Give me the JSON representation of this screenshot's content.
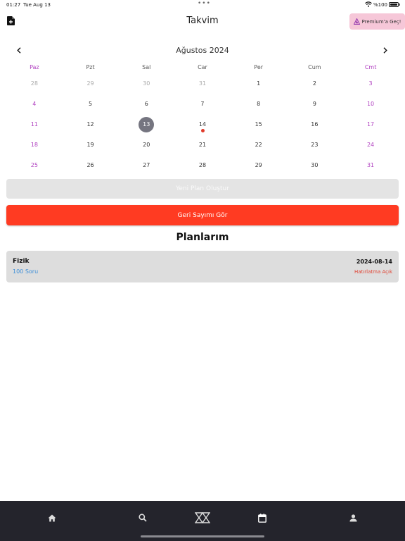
{
  "status_bar": {
    "time": "01:27",
    "date": "Tue Aug 13",
    "battery": "%100"
  },
  "header": {
    "title": "Takvim",
    "premium_label": "Premium'a Geç!"
  },
  "calendar": {
    "month_title": "Ağustos 2024",
    "weekdays": [
      "Paz",
      "Pzt",
      "Sal",
      "Car",
      "Per",
      "Cum",
      "Cmt"
    ],
    "weeks": [
      [
        "28",
        "29",
        "30",
        "31",
        "1",
        "2",
        "3"
      ],
      [
        "4",
        "5",
        "6",
        "7",
        "8",
        "9",
        "10"
      ],
      [
        "11",
        "12",
        "13",
        "14",
        "15",
        "16",
        "17"
      ],
      [
        "18",
        "19",
        "20",
        "21",
        "22",
        "23",
        "24"
      ],
      [
        "25",
        "26",
        "27",
        "28",
        "29",
        "30",
        "31"
      ]
    ],
    "selected_day": "13",
    "event_day": "14"
  },
  "actions": {
    "new_plan_label": "Yeni Plan Oluştur",
    "countdown_label": "Geri Sayımı Gör"
  },
  "plans": {
    "section_title": "Planlarım",
    "items": [
      {
        "subject": "Fizik",
        "amount": "100 Soru",
        "date": "2024-08-14",
        "reminder": "Hatırlatma Açık"
      }
    ]
  },
  "colors": {
    "accent_red": "#ff3b22",
    "weekend_purple": "#b040c0",
    "tab_bar": "#24242c",
    "premium_bg": "#f6c7d8"
  },
  "tab_bar": {
    "tabs": [
      "home-icon",
      "search-icon",
      "app-logo-icon",
      "calendar-icon",
      "profile-icon"
    ]
  }
}
